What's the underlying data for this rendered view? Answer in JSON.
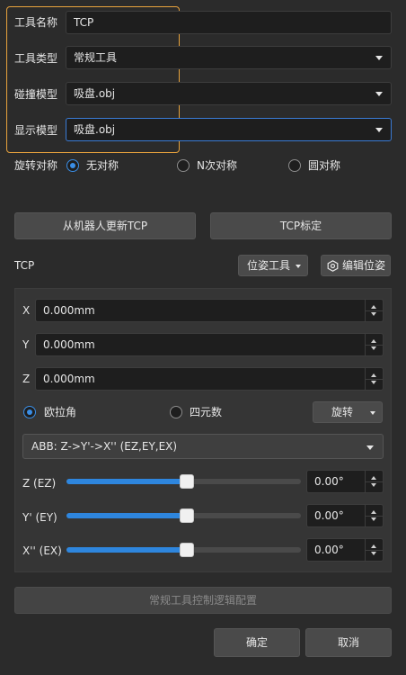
{
  "form": {
    "tool_name_label": "工具名称",
    "tool_name_value": "TCP",
    "tool_type_label": "工具类型",
    "tool_type_value": "常规工具",
    "collision_model_label": "碰撞模型",
    "collision_model_value": "吸盘.obj",
    "display_model_label": "显示模型",
    "display_model_value": "吸盘.obj",
    "rotation_symmetry_label": "旋转对称",
    "symmetry_options": [
      "无对称",
      "N次对称",
      "圆对称"
    ],
    "symmetry_selected": "无对称"
  },
  "actions": {
    "update_from_robot": "从机器人更新TCP",
    "tcp_calibrate": "TCP标定"
  },
  "tcp": {
    "section_label": "TCP",
    "pose_tool_dropdown": "位姿工具",
    "edit_pose_button": "编辑位姿",
    "x_label": "X",
    "x_value": "0.000mm",
    "y_label": "Y",
    "y_value": "0.000mm",
    "z_label": "Z",
    "z_value": "0.000mm",
    "euler_label": "欧拉角",
    "quaternion_label": "四元数",
    "orientation_selected": "欧拉角",
    "rotate_dropdown": "旋转",
    "euler_convention": "ABB: Z->Y'->X'' (EZ,EY,EX)",
    "sliders": [
      {
        "label": "Z (EZ)",
        "value": "0.00°",
        "fraction": 0.5
      },
      {
        "label": "Y' (EY)",
        "value": "0.00°",
        "fraction": 0.5
      },
      {
        "label": "X'' (EX)",
        "value": "0.00°",
        "fraction": 0.5
      }
    ]
  },
  "footer": {
    "logic_config_button": "常规工具控制逻辑配置",
    "confirm_button": "确定",
    "cancel_button": "取消"
  },
  "colors": {
    "background": "#2b2b2b",
    "accent": "#2e86de",
    "highlight_border": "#e8a33d"
  }
}
